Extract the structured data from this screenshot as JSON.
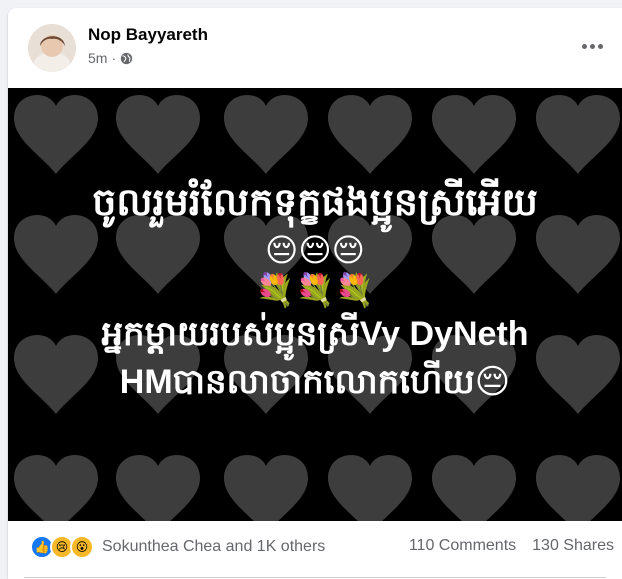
{
  "post": {
    "author_name": "Nop Bayyareth",
    "time": "5m",
    "privacy_separator": "·",
    "privacy_icon": "globe-icon",
    "more_icon": "more-options-icon"
  },
  "image_text": {
    "line1": "ចូលរួមរំលែកទុក្ខផងប្អូនស្រីអើយ",
    "emojis1": "😔😔😔",
    "emojis2": "💐💐💐",
    "line3": "អ្នកម្ដាយរបស់ប្អូនស្រីVy DyNeth",
    "line4": "HMបានលាចាកលោកហើយ😔"
  },
  "reactions": {
    "icons": [
      "like-icon",
      "sad-icon",
      "wow-icon"
    ],
    "summary": "Sokunthea Chea and 1K others",
    "comments": "110 Comments",
    "shares": "130 Shares"
  },
  "colors": {
    "like": "#1877f2",
    "emoji_yellow": "#f7b928",
    "image_bg": "#000000",
    "heart": "#3a3a3a"
  }
}
